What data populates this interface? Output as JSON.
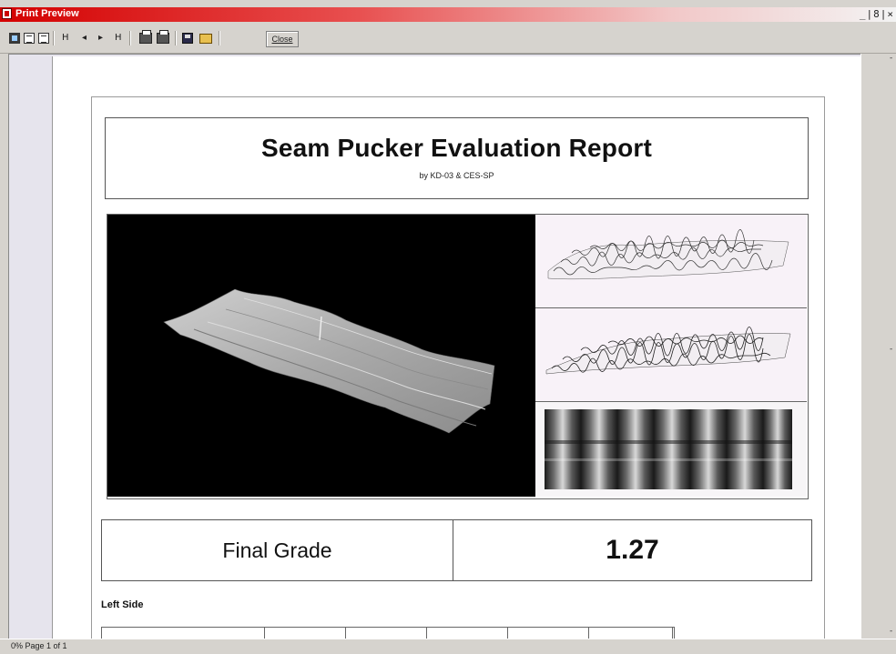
{
  "window": {
    "title": "Print Preview",
    "controls": "_|8|×"
  },
  "toolbar": {
    "nav_first": "H",
    "nav_prev": "◂",
    "nav_next": "▸",
    "nav_last": "H",
    "close_label": "Close"
  },
  "report": {
    "title": "Seam Pucker Evaluation Report",
    "subtitle": "by KD-03 & CES-SP",
    "grade_label": "Final Grade",
    "grade_value": "1.27",
    "left_side_label": "Left Side"
  },
  "status": {
    "text": "0% Page 1 of 1"
  },
  "colors": {
    "titlebar_start": "#d40000",
    "titlebar_end": "#f3f3f3",
    "app_bg": "#d6d3ce",
    "viewport_bg": "#e6e4ed"
  }
}
